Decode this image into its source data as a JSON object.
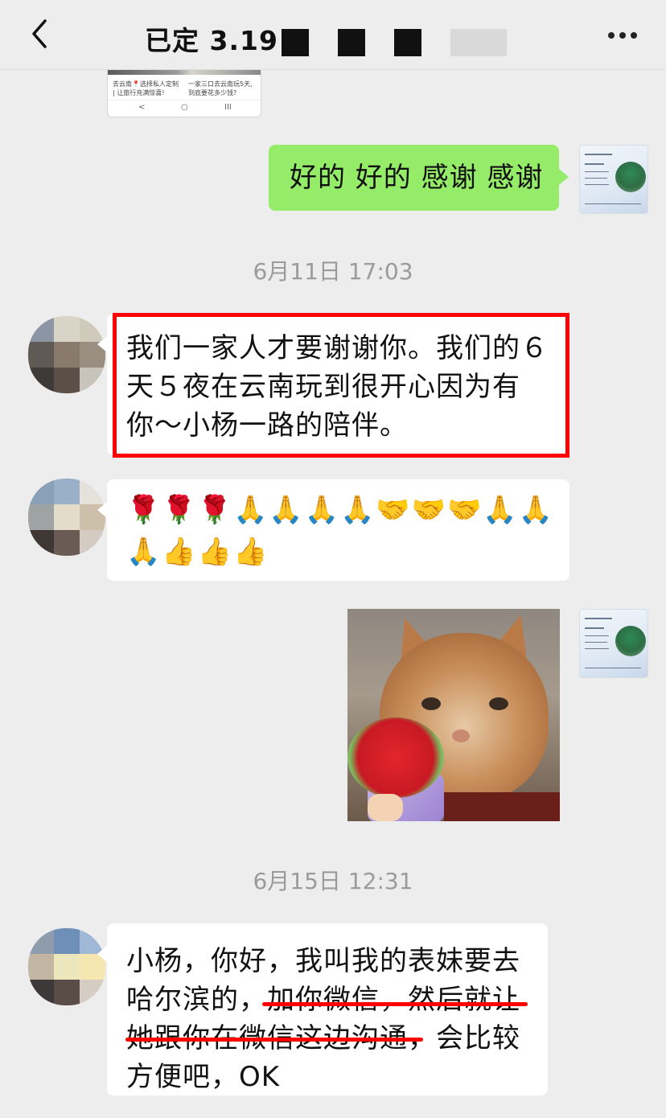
{
  "header": {
    "title": "已定 3.19",
    "back_icon": "chevron-left-icon",
    "more_icon": "more-dots-icon"
  },
  "preview_card": {
    "caption_left": "去云南📍选择私人定制 | 让旅行充满惊喜!",
    "caption_right": "一家三口去云南玩5天,到底要花多少钱?",
    "nav_back": "<",
    "nav_home": "○",
    "nav_menu": "III"
  },
  "messages": [
    {
      "side": "right",
      "text": "好的 好的 感谢 感谢"
    },
    {
      "type": "timestamp",
      "text": "6月11日 17:03"
    },
    {
      "side": "left",
      "lines": [
        "我们一家人才要谢谢你。我们的６",
        "天５夜在云南玩到很开心因为有",
        "你～小杨一路的陪伴。"
      ]
    },
    {
      "side": "left",
      "emoji_lines": [
        "🌹🌹🌹🙏🙏🙏🙏🤝🤝🤝🙏🙏",
        "🙏👍👍👍"
      ]
    },
    {
      "side": "right",
      "type": "sticker",
      "icon": "cat-with-flowers-sticker"
    },
    {
      "type": "timestamp",
      "text": "6月15日 12:31"
    },
    {
      "side": "left",
      "lines": [
        "小杨，你好，我叫我的表妹要去",
        "哈尔滨的，加你微信，然后就让",
        "她跟你在微信这边沟通，会比较",
        "方便吧，OK"
      ]
    }
  ],
  "colors": {
    "background": "#ededed",
    "self_bubble": "#95ec69",
    "other_bubble": "#ffffff",
    "annotation": "#ff0000"
  }
}
